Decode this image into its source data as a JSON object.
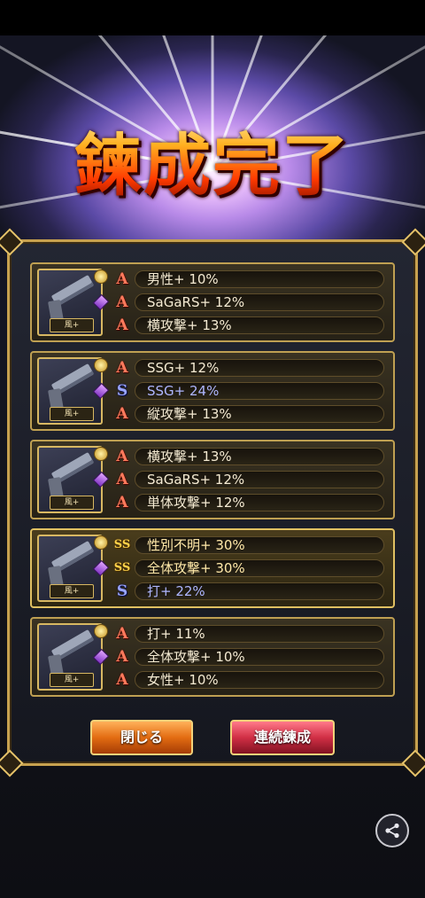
{
  "title": "鍊成完了",
  "cards": [
    {
      "weapon_tag": "風+",
      "rows": [
        {
          "grade": "A",
          "text": "男性+ 10%"
        },
        {
          "grade": "A",
          "text": "SaGaRS+ 12%"
        },
        {
          "grade": "A",
          "text": "横攻撃+ 13%"
        }
      ]
    },
    {
      "weapon_tag": "風+",
      "rows": [
        {
          "grade": "A",
          "text": "SSG+ 12%"
        },
        {
          "grade": "S",
          "text": "SSG+ 24%"
        },
        {
          "grade": "A",
          "text": "縦攻撃+ 13%"
        }
      ]
    },
    {
      "weapon_tag": "風+",
      "rows": [
        {
          "grade": "A",
          "text": "横攻撃+ 13%"
        },
        {
          "grade": "A",
          "text": "SaGaRS+ 12%"
        },
        {
          "grade": "A",
          "text": "単体攻撃+ 12%"
        }
      ]
    },
    {
      "weapon_tag": "風+",
      "rows": [
        {
          "grade": "SS",
          "text": "性別不明+ 30%"
        },
        {
          "grade": "SS",
          "text": "全体攻撃+ 30%"
        },
        {
          "grade": "S",
          "text": "打+ 22%"
        }
      ]
    },
    {
      "weapon_tag": "風+",
      "rows": [
        {
          "grade": "A",
          "text": "打+ 11%"
        },
        {
          "grade": "A",
          "text": "全体攻撃+ 10%"
        },
        {
          "grade": "A",
          "text": "女性+ 10%"
        }
      ]
    }
  ],
  "buttons": {
    "close_label": "閉じる",
    "continue_label": "連続鍊成"
  },
  "icons": {
    "share": "share-icon",
    "grade_a": "grade-a-icon",
    "grade_s": "grade-s-icon",
    "grade_ss": "grade-ss-icon"
  },
  "colors": {
    "grade_a": "#ff7a5c",
    "grade_s": "#9aa6ff",
    "grade_ss": "#ffd24a",
    "panel_border": "#c7a14f"
  }
}
